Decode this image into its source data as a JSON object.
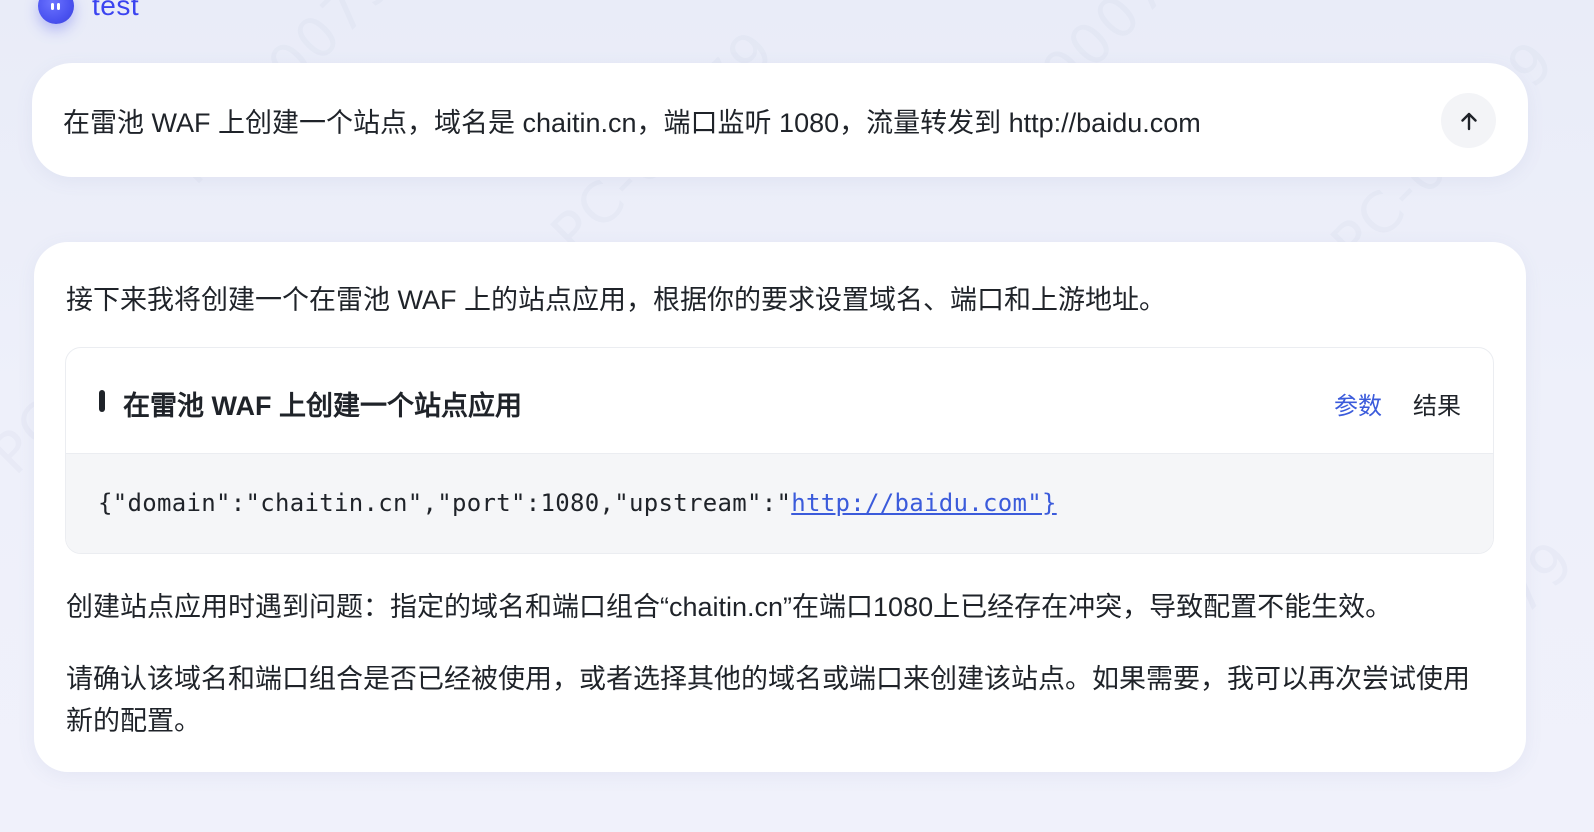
{
  "header": {
    "title": "test",
    "avatar_icon": "robot-avatar-icon"
  },
  "prompt": {
    "text": "在雷池 WAF 上创建一个站点，域名是 chaitin.cn，端口监听 1080，流量转发到 http://baidu.com",
    "send_icon": "arrow-up-icon"
  },
  "response": {
    "intro": "接下来我将创建一个在雷池 WAF 上的站点应用，根据你的要求设置域名、端口和上游地址。",
    "tool": {
      "title": "在雷池 WAF 上创建一个站点应用",
      "tabs": {
        "params": "参数",
        "result": "结果"
      },
      "code_prefix": "{\"domain\":\"chaitin.cn\",\"port\":1080,\"upstream\":\"",
      "code_link": "http://baidu.com\"}"
    },
    "paragraph_1": "创建站点应用时遇到问题：指定的域名和端口组合“chaitin.cn”在端口1080上已经存在冲突，导致配置不能生效。",
    "paragraph_2": "请确认该域名和端口组合是否已经被使用，或者选择其他的域名或端口来创建该站点。如果需要，我可以再次尝试使用新的配置。"
  },
  "colors": {
    "accent": "#3b44f0",
    "link": "#3b5bdb",
    "background": "#eceefa",
    "card": "#ffffff",
    "code_bg": "#f5f6f8"
  }
}
